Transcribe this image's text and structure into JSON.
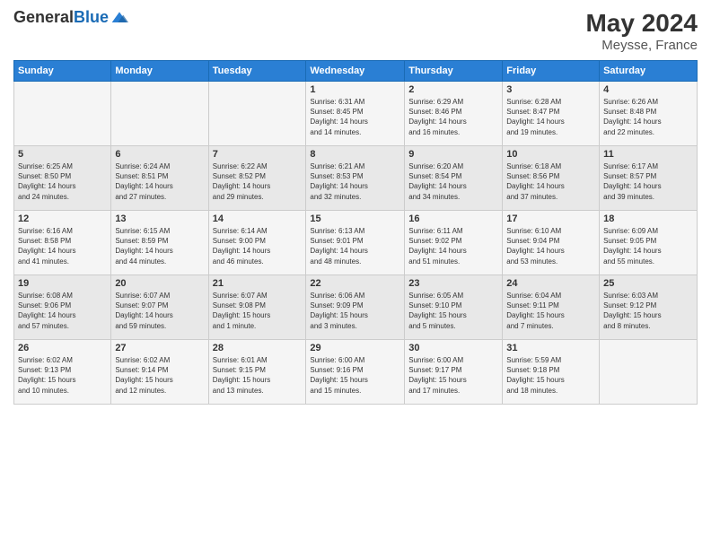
{
  "header": {
    "logo_line1": "General",
    "logo_line2": "Blue",
    "month_year": "May 2024",
    "location": "Meysse, France"
  },
  "weekdays": [
    "Sunday",
    "Monday",
    "Tuesday",
    "Wednesday",
    "Thursday",
    "Friday",
    "Saturday"
  ],
  "weeks": [
    [
      {
        "day": "",
        "info": ""
      },
      {
        "day": "",
        "info": ""
      },
      {
        "day": "",
        "info": ""
      },
      {
        "day": "1",
        "info": "Sunrise: 6:31 AM\nSunset: 8:45 PM\nDaylight: 14 hours\nand 14 minutes."
      },
      {
        "day": "2",
        "info": "Sunrise: 6:29 AM\nSunset: 8:46 PM\nDaylight: 14 hours\nand 16 minutes."
      },
      {
        "day": "3",
        "info": "Sunrise: 6:28 AM\nSunset: 8:47 PM\nDaylight: 14 hours\nand 19 minutes."
      },
      {
        "day": "4",
        "info": "Sunrise: 6:26 AM\nSunset: 8:48 PM\nDaylight: 14 hours\nand 22 minutes."
      }
    ],
    [
      {
        "day": "5",
        "info": "Sunrise: 6:25 AM\nSunset: 8:50 PM\nDaylight: 14 hours\nand 24 minutes."
      },
      {
        "day": "6",
        "info": "Sunrise: 6:24 AM\nSunset: 8:51 PM\nDaylight: 14 hours\nand 27 minutes."
      },
      {
        "day": "7",
        "info": "Sunrise: 6:22 AM\nSunset: 8:52 PM\nDaylight: 14 hours\nand 29 minutes."
      },
      {
        "day": "8",
        "info": "Sunrise: 6:21 AM\nSunset: 8:53 PM\nDaylight: 14 hours\nand 32 minutes."
      },
      {
        "day": "9",
        "info": "Sunrise: 6:20 AM\nSunset: 8:54 PM\nDaylight: 14 hours\nand 34 minutes."
      },
      {
        "day": "10",
        "info": "Sunrise: 6:18 AM\nSunset: 8:56 PM\nDaylight: 14 hours\nand 37 minutes."
      },
      {
        "day": "11",
        "info": "Sunrise: 6:17 AM\nSunset: 8:57 PM\nDaylight: 14 hours\nand 39 minutes."
      }
    ],
    [
      {
        "day": "12",
        "info": "Sunrise: 6:16 AM\nSunset: 8:58 PM\nDaylight: 14 hours\nand 41 minutes."
      },
      {
        "day": "13",
        "info": "Sunrise: 6:15 AM\nSunset: 8:59 PM\nDaylight: 14 hours\nand 44 minutes."
      },
      {
        "day": "14",
        "info": "Sunrise: 6:14 AM\nSunset: 9:00 PM\nDaylight: 14 hours\nand 46 minutes."
      },
      {
        "day": "15",
        "info": "Sunrise: 6:13 AM\nSunset: 9:01 PM\nDaylight: 14 hours\nand 48 minutes."
      },
      {
        "day": "16",
        "info": "Sunrise: 6:11 AM\nSunset: 9:02 PM\nDaylight: 14 hours\nand 51 minutes."
      },
      {
        "day": "17",
        "info": "Sunrise: 6:10 AM\nSunset: 9:04 PM\nDaylight: 14 hours\nand 53 minutes."
      },
      {
        "day": "18",
        "info": "Sunrise: 6:09 AM\nSunset: 9:05 PM\nDaylight: 14 hours\nand 55 minutes."
      }
    ],
    [
      {
        "day": "19",
        "info": "Sunrise: 6:08 AM\nSunset: 9:06 PM\nDaylight: 14 hours\nand 57 minutes."
      },
      {
        "day": "20",
        "info": "Sunrise: 6:07 AM\nSunset: 9:07 PM\nDaylight: 14 hours\nand 59 minutes."
      },
      {
        "day": "21",
        "info": "Sunrise: 6:07 AM\nSunset: 9:08 PM\nDaylight: 15 hours\nand 1 minute."
      },
      {
        "day": "22",
        "info": "Sunrise: 6:06 AM\nSunset: 9:09 PM\nDaylight: 15 hours\nand 3 minutes."
      },
      {
        "day": "23",
        "info": "Sunrise: 6:05 AM\nSunset: 9:10 PM\nDaylight: 15 hours\nand 5 minutes."
      },
      {
        "day": "24",
        "info": "Sunrise: 6:04 AM\nSunset: 9:11 PM\nDaylight: 15 hours\nand 7 minutes."
      },
      {
        "day": "25",
        "info": "Sunrise: 6:03 AM\nSunset: 9:12 PM\nDaylight: 15 hours\nand 8 minutes."
      }
    ],
    [
      {
        "day": "26",
        "info": "Sunrise: 6:02 AM\nSunset: 9:13 PM\nDaylight: 15 hours\nand 10 minutes."
      },
      {
        "day": "27",
        "info": "Sunrise: 6:02 AM\nSunset: 9:14 PM\nDaylight: 15 hours\nand 12 minutes."
      },
      {
        "day": "28",
        "info": "Sunrise: 6:01 AM\nSunset: 9:15 PM\nDaylight: 15 hours\nand 13 minutes."
      },
      {
        "day": "29",
        "info": "Sunrise: 6:00 AM\nSunset: 9:16 PM\nDaylight: 15 hours\nand 15 minutes."
      },
      {
        "day": "30",
        "info": "Sunrise: 6:00 AM\nSunset: 9:17 PM\nDaylight: 15 hours\nand 17 minutes."
      },
      {
        "day": "31",
        "info": "Sunrise: 5:59 AM\nSunset: 9:18 PM\nDaylight: 15 hours\nand 18 minutes."
      },
      {
        "day": "",
        "info": ""
      }
    ]
  ]
}
